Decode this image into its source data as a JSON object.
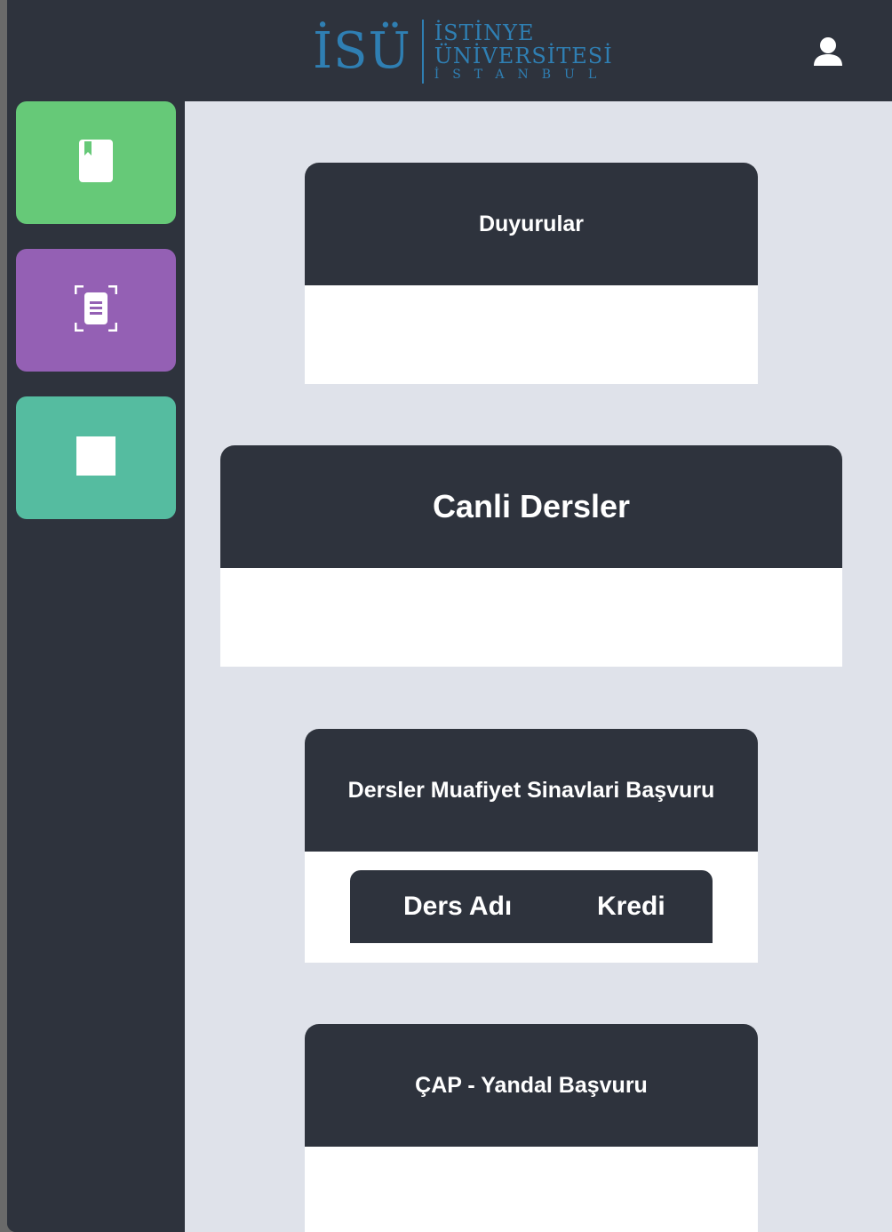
{
  "header": {
    "logo_mark": "İSÜ",
    "logo_line1": "İSTİNYE",
    "logo_line2": "ÜNİVERSİTESİ",
    "logo_line3": "İSTANBUL",
    "user_icon": "user-icon",
    "logo_color": "#2f7fb3"
  },
  "sidebar": {
    "items": [
      {
        "icon": "book-icon",
        "color": "#66c978"
      },
      {
        "icon": "document-scan-icon",
        "color": "#9460b4"
      },
      {
        "icon": "square-icon",
        "color": "#55bca0"
      }
    ]
  },
  "cards": {
    "duyurular": {
      "title": "Duyurular"
    },
    "canli_dersler": {
      "title": "Canli Dersler"
    },
    "muafiyet": {
      "title": "Dersler Muafiyet Sinavlari Başvuru",
      "table_headers": [
        "Ders Adı",
        "Kredi"
      ]
    },
    "cap": {
      "title": "ÇAP - Yandal Başvuru"
    }
  },
  "colors": {
    "dark": "#2e333d",
    "content_bg": "#dfe2ea"
  }
}
